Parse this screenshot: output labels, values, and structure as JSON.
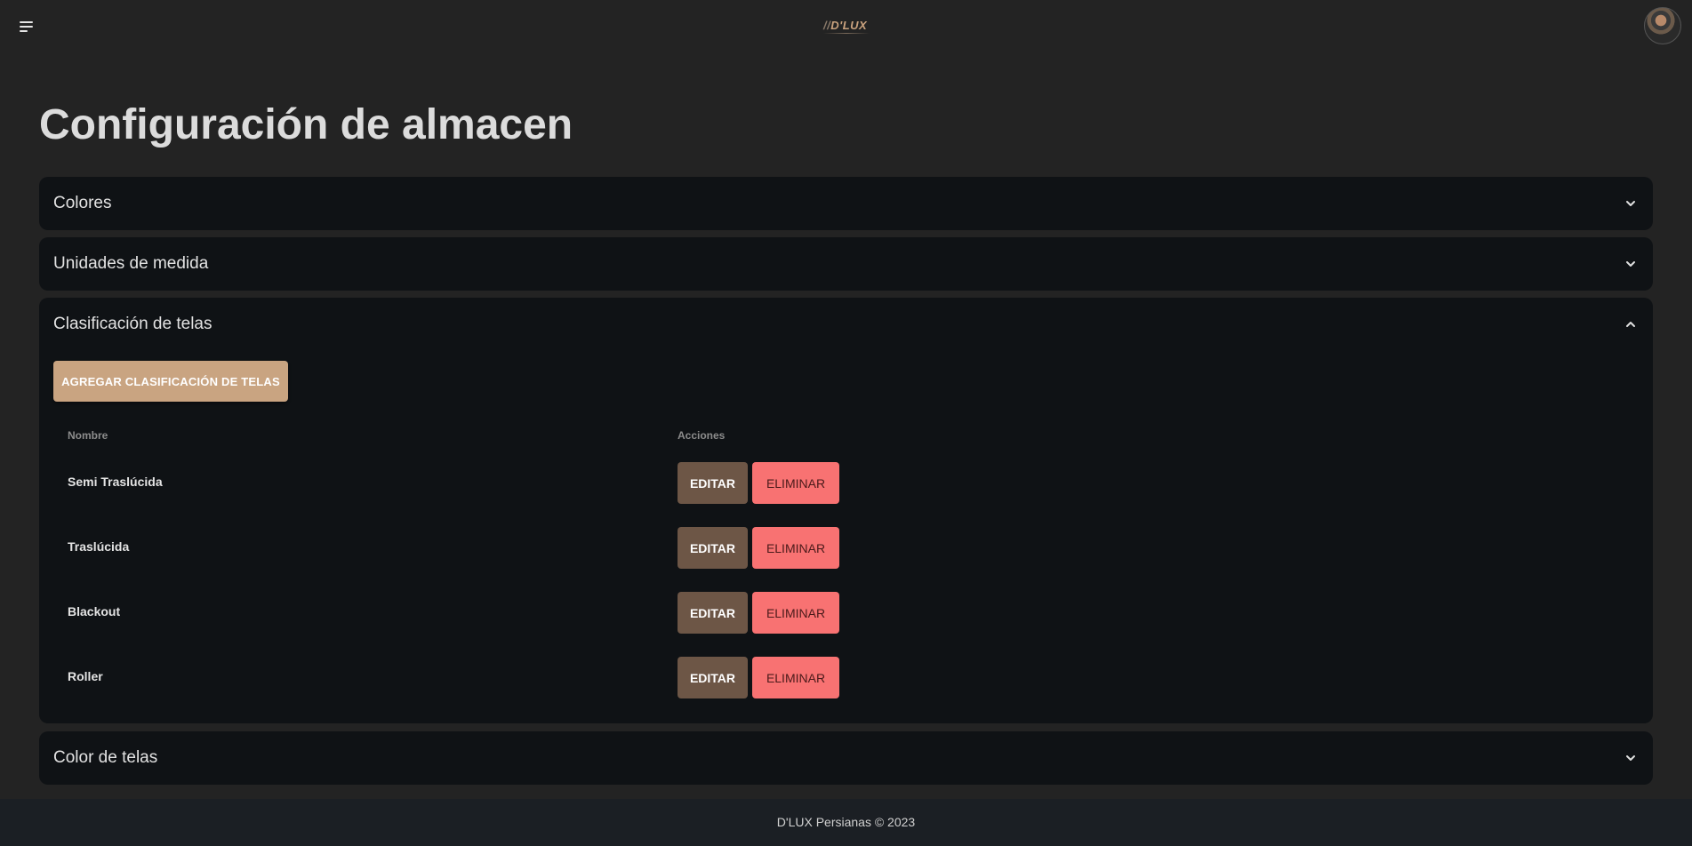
{
  "header": {
    "logo_text": "D'LUX",
    "logo_prefix": "//",
    "menu_icon": "hamburger-menu-icon",
    "avatar_icon": "user-avatar"
  },
  "page": {
    "title": "Configuración de almacen"
  },
  "panels": [
    {
      "title": "Colores",
      "expanded": false
    },
    {
      "title": "Unidades de medida",
      "expanded": false
    },
    {
      "title": "Clasificación de telas",
      "expanded": true,
      "add_button_label": "AGREGAR CLASIFICACIÓN DE TELAS",
      "columns": [
        "Nombre",
        "Acciones"
      ],
      "rows": [
        {
          "name": "Semi Traslúcida",
          "edit_label": "EDITAR",
          "delete_label": "ELIMINAR"
        },
        {
          "name": "Traslúcida",
          "edit_label": "EDITAR",
          "delete_label": "ELIMINAR"
        },
        {
          "name": "Blackout",
          "edit_label": "EDITAR",
          "delete_label": "ELIMINAR"
        },
        {
          "name": "Roller",
          "edit_label": "EDITAR",
          "delete_label": "ELIMINAR"
        }
      ]
    },
    {
      "title": "Color de telas",
      "expanded": false
    }
  ],
  "footer": {
    "text": "D'LUX Persianas © 2023"
  },
  "colors": {
    "background": "#232323",
    "panel": "#0f1215",
    "accent_button": "#c9a481",
    "edit_button": "#6d5646",
    "delete_button": "#f87272",
    "footer": "#1b1f24"
  }
}
